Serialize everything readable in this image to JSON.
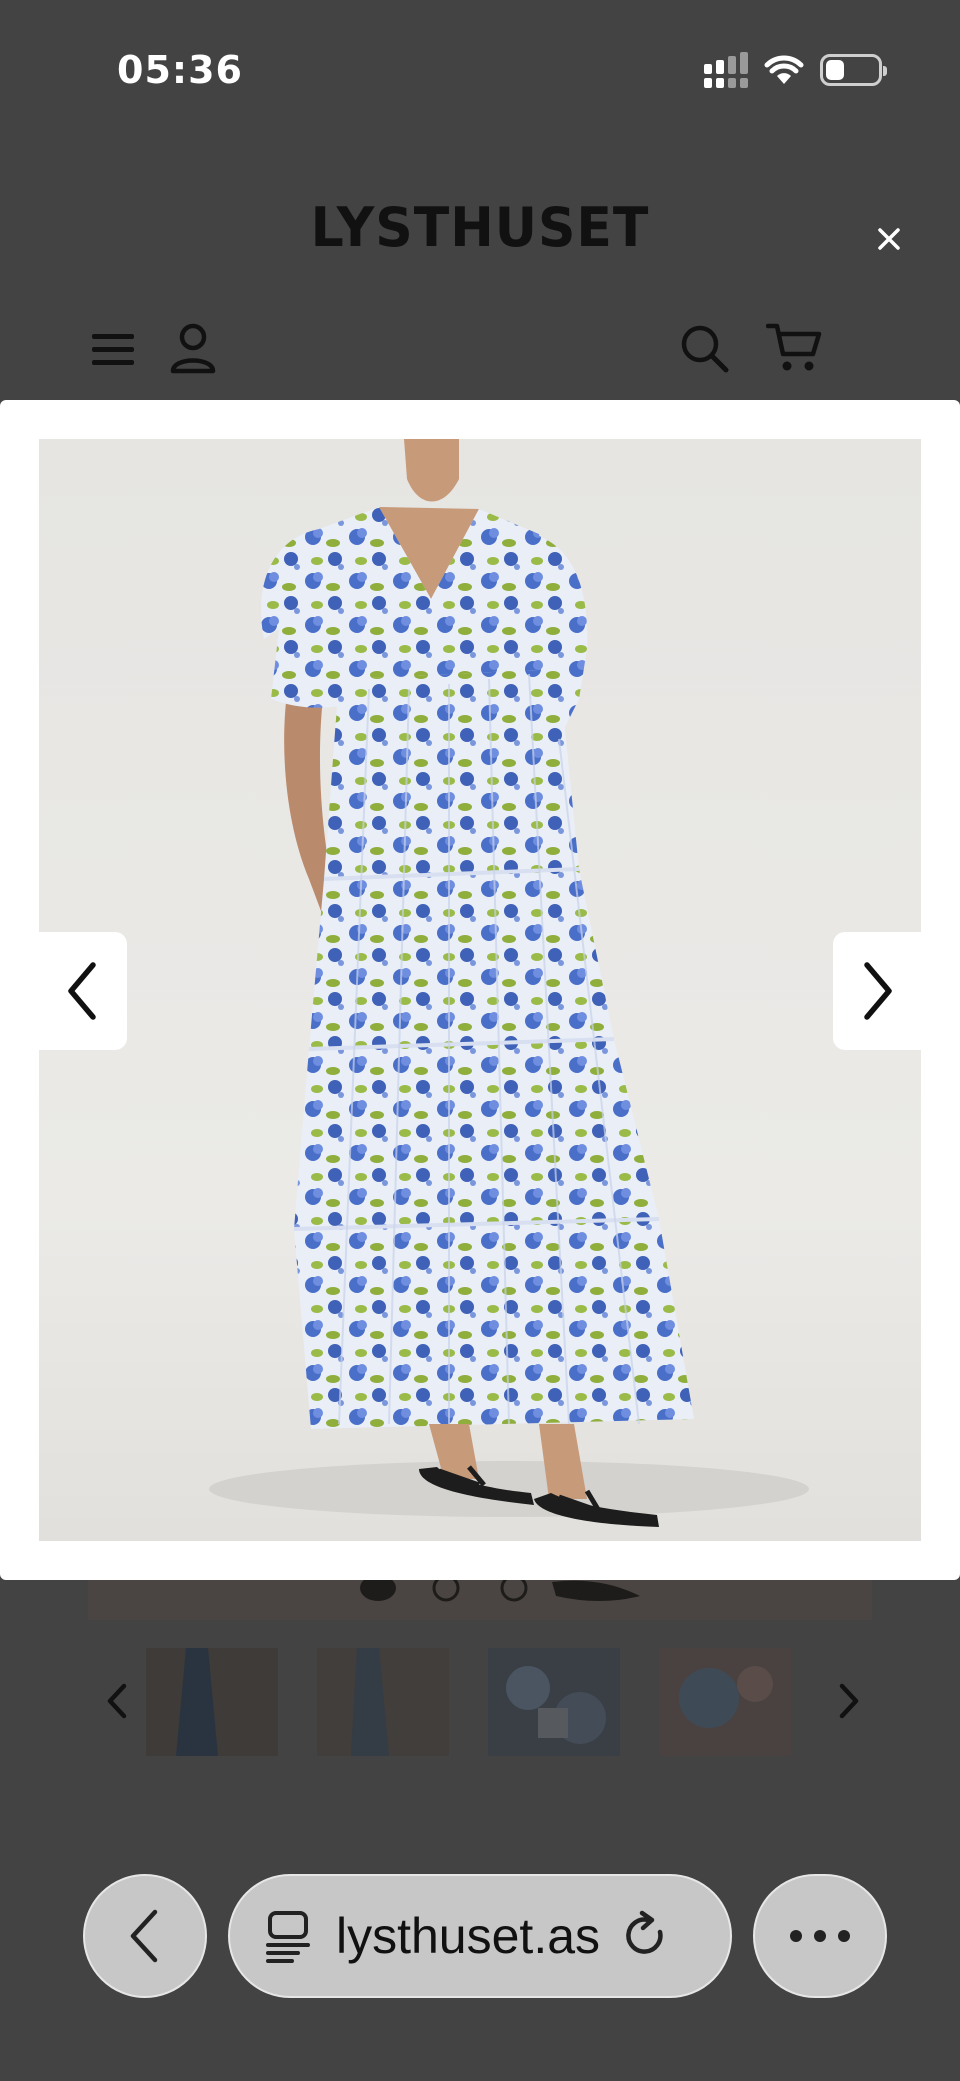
{
  "status_bar": {
    "time": "05:36",
    "icons": [
      "cellular-signal-icon",
      "wifi-icon",
      "battery-icon"
    ]
  },
  "site_header": {
    "logo": "LYSTHUSET",
    "icons": [
      "menu-icon",
      "account-icon",
      "search-icon",
      "cart-icon"
    ]
  },
  "modal": {
    "close_icon": "close-icon",
    "image_subject": "product-photo-floral-maxi-dress",
    "prev_icon": "chevron-left-icon",
    "next_icon": "chevron-right-icon"
  },
  "gallery": {
    "dots_count": 3,
    "active_dot": 1,
    "thumbnail_count": 4
  },
  "browser_bar": {
    "back_icon": "chevron-left-icon",
    "tabs_icon": "tab-overview-icon",
    "url": "lysthuset.as",
    "reload_icon": "reload-icon",
    "more_icon": "ellipsis-icon"
  },
  "colors": {
    "overlay": "#434343",
    "modal_bg": "#ffffff",
    "dress_blue": "#4a6fc9",
    "dress_green": "#8fae3c",
    "pill_bg": "#c7c7c7"
  }
}
